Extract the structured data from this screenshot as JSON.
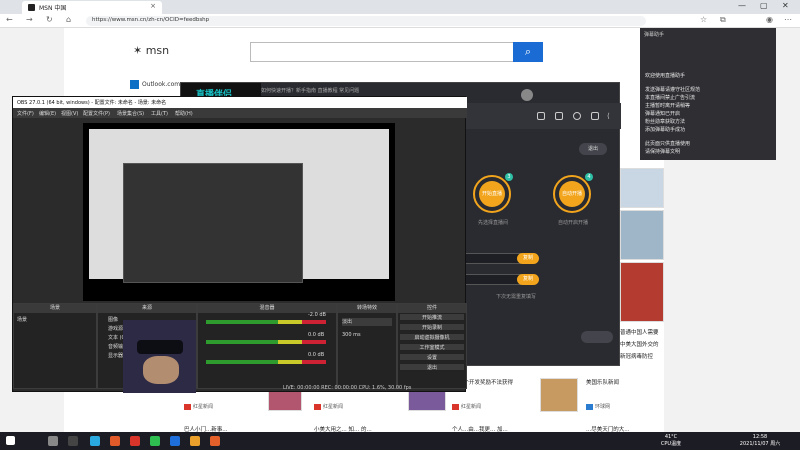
{
  "browser": {
    "tab_title": "MSN 中国",
    "url": "https://www.msn.cn/zh-cn/OCID=feedbshp"
  },
  "msn": {
    "logo": "msn",
    "outlook": "Outlook.com",
    "news": [
      {
        "title": "首个开发奖励不法获得",
        "source": "红星新闻"
      },
      {
        "title": "全球人类新发现",
        "source": "红星新闻"
      },
      {
        "title": "超高温探测新进展的问题",
        "source": "红星新闻"
      },
      {
        "title": "新闻中心最新发布",
        "source": "红星新闻"
      },
      {
        "title": "美国乐队新闻",
        "source": "环球网"
      }
    ],
    "right_news": [
      "普通中国人需要",
      "中美大国外交的",
      "新冠病毒防控"
    ],
    "bottom_news": [
      "巴人小门...新事...",
      "小美大用之... 知... 的...",
      "个人...由...我更... 加...",
      "...尽美天门的大..."
    ]
  },
  "darkapp": {
    "banner": "直播伴侣",
    "topline": "如何快速开播？新手指南 直播教程 常见问题",
    "step1": "开始直播",
    "step2": "自动开播",
    "desc1": "先选择直播间",
    "desc2": "自动开启开播",
    "field1_btn": "复制",
    "field2_btn": "复制",
    "hint": "下次无需重复填写",
    "right_btn": "退出"
  },
  "chat": {
    "header": "弹幕助手",
    "lines": [
      "欢迎使用直播助手",
      "发送弹幕请遵守社区规范",
      "本直播间禁止广告引流",
      "主播暂时离开请稍等",
      "弹幕通知已开启",
      "粉丝勋章获取方法",
      "添加弹幕助手成功",
      "",
      "此页面只供直播使用",
      "请保持弹幕文明"
    ]
  },
  "obs": {
    "title": "OBS 27.0.1 (64 bit, windows) - 配置文件: 未命名 - 场景: 未命名",
    "menu": [
      "文件(F)",
      "编辑(E)",
      "视图(V)",
      "配置文件(P)",
      "场景集合(S)",
      "工具(T)",
      "帮助(H)"
    ],
    "docks": {
      "scenes": "场景",
      "sources": "来源",
      "mixer": "混音器",
      "transitions": "转场特效",
      "controls": "控件"
    },
    "scene_item": "场景",
    "sources": [
      "图像",
      "游戏源",
      "文本 (GDI+)",
      "音频输入",
      "显示器采集"
    ],
    "transition": "淡出",
    "duration": "300 ms",
    "controls": [
      "开始推流",
      "开始录制",
      "启动虚拟摄像机",
      "工作室模式",
      "设置",
      "退出"
    ],
    "status": "LIVE: 00:00:00  REC: 00:00:00  CPU: 1.6%, 30.00 fps",
    "mixer_levels": [
      "-2.0 dB",
      "0.0 dB",
      "0.0 dB"
    ]
  },
  "taskbar": {
    "weather": "41°C",
    "weather_sub": "CPU温度",
    "time": "12:58",
    "date": "2021/11/07 周六"
  }
}
